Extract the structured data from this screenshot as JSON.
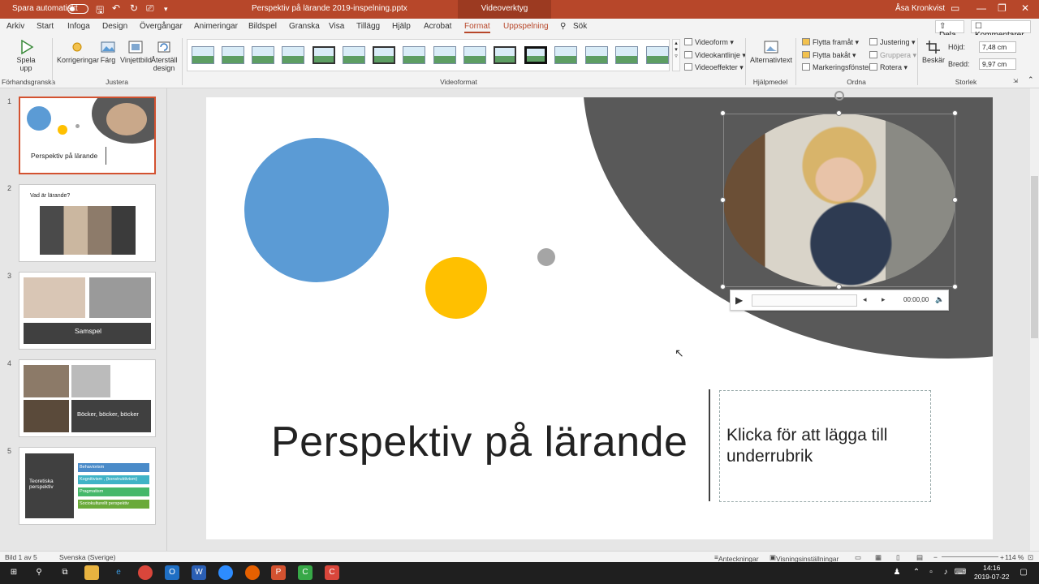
{
  "titlebar": {
    "autosave": "Spara automatiskt",
    "doc_title": "Perspektiv på lärande 2019-inspelning.pptx",
    "video_tools": "Videoverktyg",
    "user": "Åsa Kronkvist"
  },
  "tabs": [
    "Arkiv",
    "Start",
    "Infoga",
    "Design",
    "Övergångar",
    "Animeringar",
    "Bildspel",
    "Granska",
    "Visa",
    "Tillägg",
    "Hjälp",
    "Acrobat",
    "Format",
    "Uppspelning"
  ],
  "search_label": "Sök",
  "share": "Dela",
  "comments": "Kommentarer",
  "ribbon": {
    "play": "Spela upp",
    "corrections": "Korrigeringar",
    "color": "Färg",
    "poster_frame": "Vinjettbild",
    "reset_design": "Återställ design",
    "video_shape": "Videoform",
    "video_border": "Videokantlinje",
    "video_effects": "Videoeffekter",
    "alt_text": "Alternativtext",
    "bring_forward": "Flytta framåt",
    "send_backward": "Flytta bakåt",
    "selection_pane": "Markeringsfönster",
    "align": "Justering",
    "group": "Gruppera",
    "rotate": "Rotera",
    "crop": "Beskär",
    "height_label": "Höjd:",
    "height_value": "7,48 cm",
    "width_label": "Bredd:",
    "width_value": "9,97 cm",
    "groups": {
      "preview": "Förhandsgranska",
      "adjust": "Justera",
      "video_styles": "Videoformat",
      "accessibility": "Hjälpmedel",
      "arrange": "Ordna",
      "size": "Storlek"
    }
  },
  "thumbnails": [
    {
      "num": "1",
      "text": "Perspektiv på lärande"
    },
    {
      "num": "2",
      "text": "Vad är lärande?"
    },
    {
      "num": "3",
      "text": "Samspel"
    },
    {
      "num": "4",
      "text": "Böcker, böcker, böcker"
    },
    {
      "num": "5",
      "text": "Teoretiska perspektiv",
      "items": [
        "Behaviorism",
        "Kognitivism , (konstruktivism)",
        "Pragmatism",
        "Sociokulturellt perspektiv"
      ]
    }
  ],
  "slide": {
    "title": "Perspektiv på lärande",
    "subtitle_placeholder": "Klicka för att lägga till underrubrik",
    "colors": {
      "blue": "#5b9bd5",
      "yellow": "#ffc000",
      "gray": "#a5a5a5",
      "dark": "#595959"
    }
  },
  "player": {
    "time": "00:00,00"
  },
  "status": {
    "slide_info": "Bild 1 av 5",
    "language": "Svenska (Sverige)",
    "notes": "Anteckningar",
    "display_settings": "Visningsinställningar",
    "zoom": "114 %"
  },
  "taskbar": {
    "time": "14:16",
    "date": "2019-07-22"
  }
}
